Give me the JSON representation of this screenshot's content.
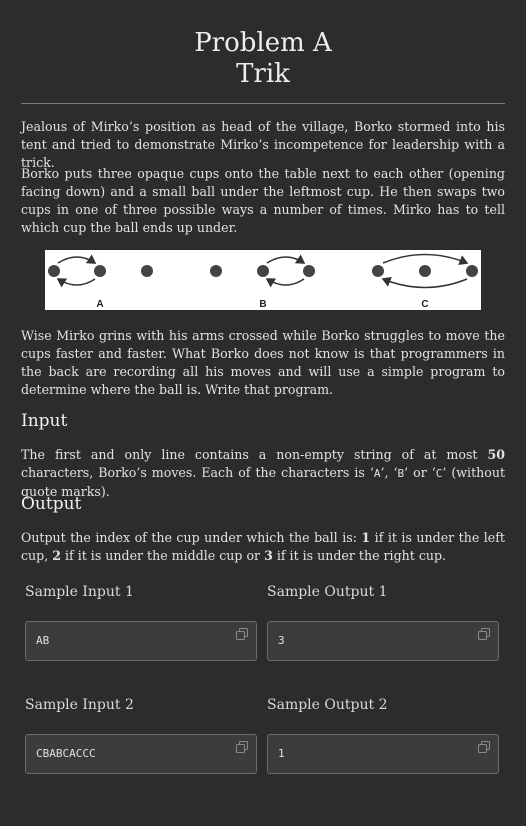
{
  "problem": {
    "title_line1": "Problem A",
    "title_line2": "Trik"
  },
  "statement": {
    "p1": "Jealous of Mirko’s position as head of the village, Borko stormed into his tent and tried to demonstrate Mirko’s incompetence for leadership with a trick.",
    "p2": "Borko puts three opaque cups onto the table next to each other (opening facing down) and a small ball under the leftmost cup. He then swaps two cups in one of three possible ways a number of times. Mirko has to tell which cup the ball ends up under.",
    "figure_labels": [
      "A",
      "B",
      "C"
    ],
    "p3": "Wise Mirko grins with his arms crossed while Borko struggles to move the cups faster and faster. What Borko does not know is that programmers in the back are recording all his moves and will use a simple program to determine where the ball is. Write that program."
  },
  "input": {
    "heading": "Input",
    "text_a": "The first and only line contains a non-empty string of at most ",
    "num": "50",
    "text_b": " characters, Borko’s moves. Each of the characters is ‘",
    "c1": "A",
    "sep1": "’, ‘",
    "c2": "B",
    "sep2": "’ or ‘",
    "c3": "C",
    "text_c": "’ (without quote marks)."
  },
  "output": {
    "heading": "Output",
    "text_a": "Output the index of the cup under which the ball is: ",
    "n1": "1",
    "text_b": " if it is under the left cup, ",
    "n2": "2",
    "text_c": " if it is under the middle cup or ",
    "n3": "3",
    "text_d": " if it is under the right cup."
  },
  "samples": [
    {
      "input_label": "Sample Input 1",
      "input_value": "AB",
      "output_label": "Sample Output 1",
      "output_value": "3"
    },
    {
      "input_label": "Sample Input 2",
      "input_value": "CBABCACCC",
      "output_label": "Sample Output 2",
      "output_value": "1"
    }
  ],
  "colors": {
    "background": "#2c2c2c",
    "text": "#e2e2e2",
    "sample_box": "#3c3c3c"
  }
}
